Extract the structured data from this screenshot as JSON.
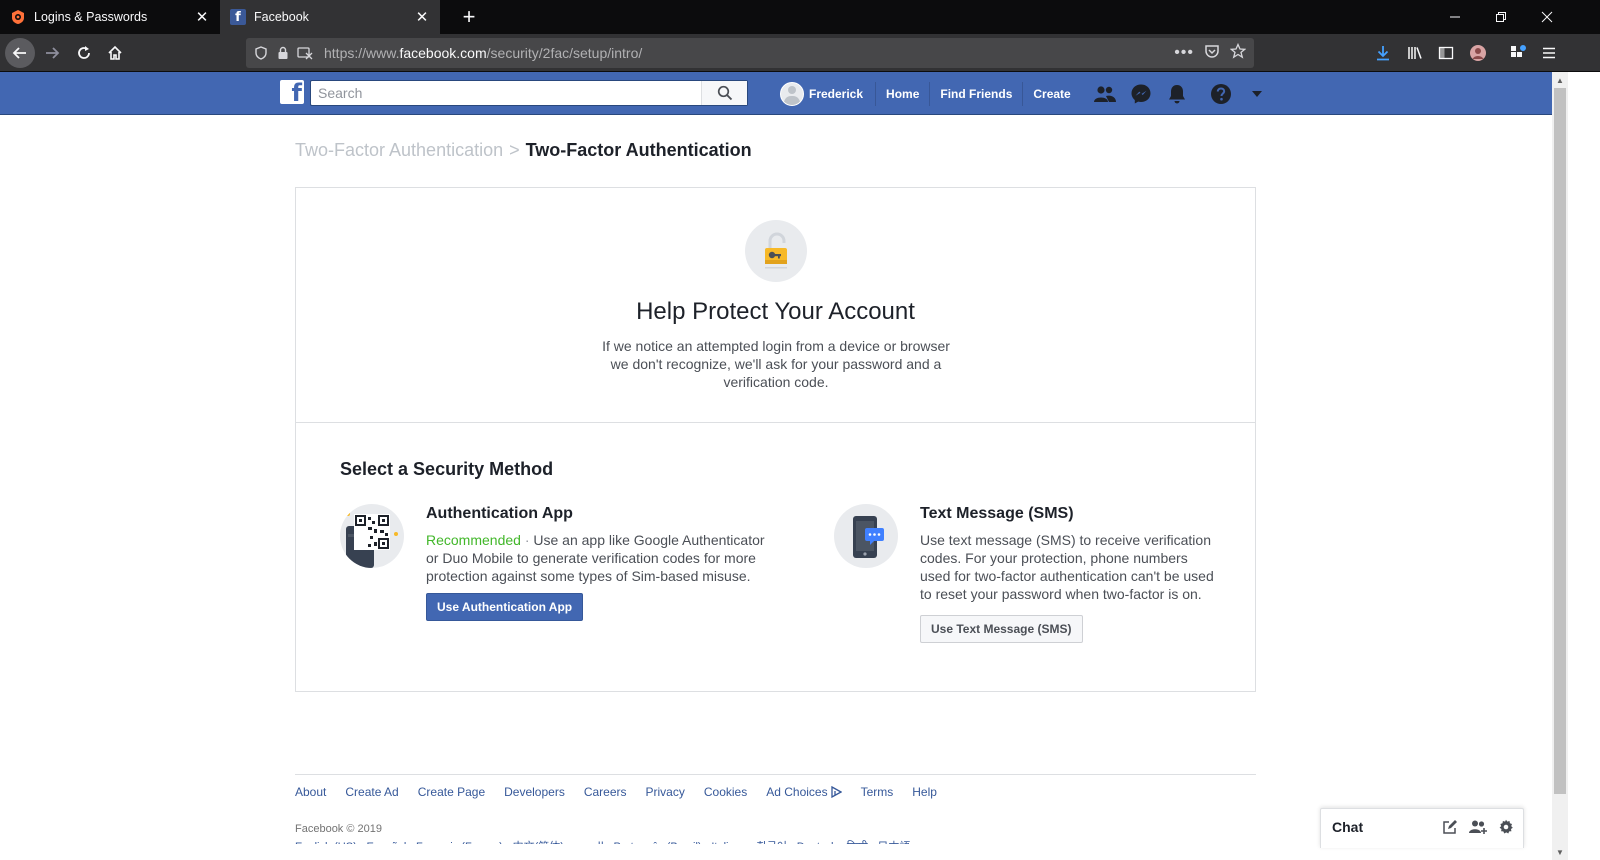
{
  "browser": {
    "tabs": [
      {
        "label": "Logins & Passwords",
        "active": false
      },
      {
        "label": "Facebook",
        "active": true
      }
    ],
    "url": {
      "prefix": "https://www.",
      "host": "facebook.com",
      "path": "/security/2fac/setup/intro/"
    }
  },
  "fb_header": {
    "search_placeholder": "Search",
    "profile_name": "Frederick",
    "nav": [
      "Home",
      "Find Friends",
      "Create"
    ]
  },
  "breadcrumb": {
    "parent": "Two-Factor Authentication",
    "separator": ">",
    "current": "Two-Factor Authentication"
  },
  "hero": {
    "title": "Help Protect Your Account",
    "description": "If we notice an attempted login from a device or browser we don't recognize, we'll ask for your password and a verification code."
  },
  "methods": {
    "heading": "Select a Security Method",
    "auth_app": {
      "name": "Authentication App",
      "recommended": "Recommended",
      "separator": " · ",
      "description": "Use an app like Google Authenticator or Duo Mobile to generate verification codes for more protection against some types of Sim-based misuse.",
      "button": "Use Authentication App"
    },
    "sms": {
      "name": "Text Message (SMS)",
      "description": "Use text message (SMS) to receive verification codes. For your protection, phone numbers used for two-factor authentication can't be used to reset your password when two-factor is on.",
      "button": "Use Text Message (SMS)"
    }
  },
  "footer": {
    "links": [
      "About",
      "Create Ad",
      "Create Page",
      "Developers",
      "Careers",
      "Privacy",
      "Cookies",
      "Ad Choices",
      "Terms",
      "Help"
    ],
    "copyright": "Facebook © 2019",
    "languages": "English (US) · Español · Français (France) · 中文(简体) · العربية · Português (Brasil) · Italiano · 한국어 · Deutsch · हिन्दी · 日本語"
  },
  "chat": {
    "label": "Chat"
  },
  "colors": {
    "fb_blue": "#4267b2",
    "recommended_green": "#42b72a",
    "link_blue": "#365899",
    "browser_dark": "#0c0c0d"
  }
}
